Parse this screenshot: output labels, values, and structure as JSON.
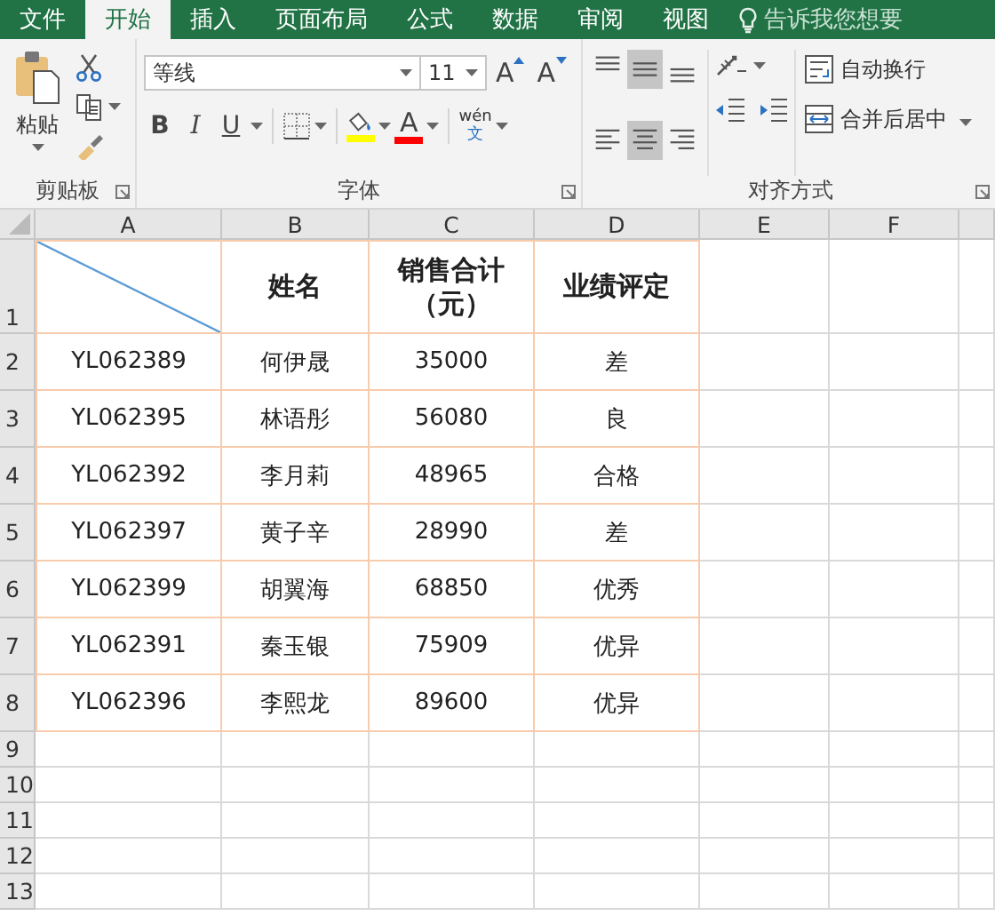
{
  "tabs": [
    {
      "label": "文件",
      "selected": false
    },
    {
      "label": "开始",
      "selected": true
    },
    {
      "label": "插入",
      "selected": false
    },
    {
      "label": "页面布局",
      "selected": false
    },
    {
      "label": "公式",
      "selected": false
    },
    {
      "label": "数据",
      "selected": false
    },
    {
      "label": "审阅",
      "selected": false
    },
    {
      "label": "视图",
      "selected": false
    }
  ],
  "tell_me": {
    "placeholder": "告诉我您想要"
  },
  "clipboard": {
    "paste_label": "粘贴",
    "group_label": "剪贴板"
  },
  "font": {
    "name": "等线",
    "size": "11",
    "group_label": "字体",
    "size_buttons": [
      {
        "kind": "grow",
        "glyph": "A"
      },
      {
        "kind": "shrink",
        "glyph": "A"
      }
    ],
    "format_buttons": [
      {
        "kind": "bold",
        "glyph": "B"
      },
      {
        "kind": "italic",
        "glyph": "I"
      },
      {
        "kind": "underline",
        "glyph": "U"
      },
      {
        "kind": "border"
      },
      {
        "kind": "fill",
        "color": "#ffff00"
      },
      {
        "kind": "font-color",
        "glyph": "A",
        "color": "#ff0000"
      },
      {
        "kind": "phonetic",
        "glyph": "wén",
        "glyph2": "文"
      }
    ]
  },
  "alignment": {
    "group_label": "对齐方式",
    "vertical": [
      {
        "kind": "top",
        "selected": false
      },
      {
        "kind": "middle",
        "selected": true
      },
      {
        "kind": "bottom",
        "selected": false
      }
    ],
    "horizontal": [
      {
        "kind": "left",
        "selected": false
      },
      {
        "kind": "center",
        "selected": true
      },
      {
        "kind": "right",
        "selected": false
      }
    ],
    "wrap_label": "自动换行",
    "merge_label": "合并后居中"
  },
  "sheet": {
    "columns": [
      "A",
      "B",
      "C",
      "D",
      "E",
      "F"
    ],
    "header_row": {
      "number": "1",
      "cells": [
        {
          "kind": "diagonal"
        },
        {
          "kind": "text",
          "text": "姓名"
        },
        {
          "kind": "text",
          "text": "销售合计（元）"
        },
        {
          "kind": "text",
          "text": "业绩评定"
        }
      ]
    },
    "rows": [
      {
        "number": "2",
        "cells": [
          "YL062389",
          "何伊晟",
          "35000",
          "差"
        ]
      },
      {
        "number": "3",
        "cells": [
          "YL062395",
          "林语彤",
          "56080",
          "良"
        ]
      },
      {
        "number": "4",
        "cells": [
          "YL062392",
          "李月莉",
          "48965",
          "合格"
        ]
      },
      {
        "number": "5",
        "cells": [
          "YL062397",
          "黄子辛",
          "28990",
          "差"
        ]
      },
      {
        "number": "6",
        "cells": [
          "YL062399",
          "胡翼海",
          "68850",
          "优秀"
        ]
      },
      {
        "number": "7",
        "cells": [
          "YL062391",
          "秦玉银",
          "75909",
          "优异"
        ]
      },
      {
        "number": "8",
        "cells": [
          "YL062396",
          "李熙龙",
          "89600",
          "优异"
        ]
      }
    ],
    "empty_rows": [
      "9",
      "10",
      "11",
      "12",
      "13"
    ]
  }
}
